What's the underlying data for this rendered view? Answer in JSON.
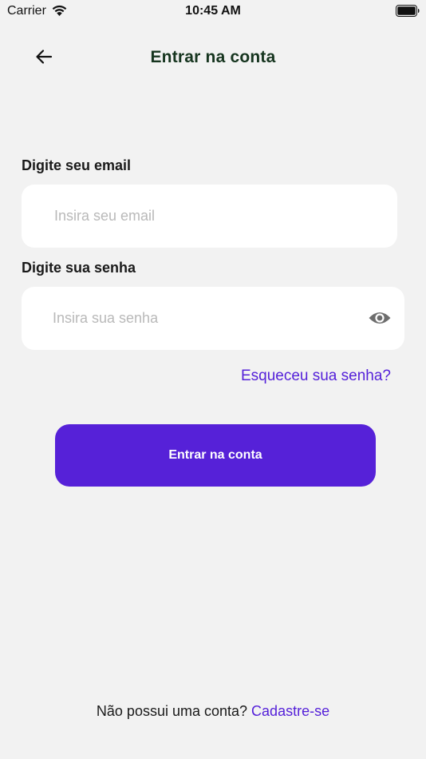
{
  "status_bar": {
    "carrier": "Carrier",
    "time": "10:45 AM"
  },
  "header": {
    "title": "Entrar na conta",
    "back_icon": "arrow-left-icon"
  },
  "form": {
    "email_label": "Digite seu email",
    "email_placeholder": "Insira seu email",
    "email_value": "",
    "password_label": "Digite sua senha",
    "password_placeholder": "Insira sua senha",
    "password_value": "",
    "password_toggle_icon": "eye-icon",
    "forgot_password": "Esqueceu sua senha?",
    "submit_label": "Entrar na conta"
  },
  "footer": {
    "no_account_text": "Não possui uma conta?",
    "signup_link": "Cadastre-se"
  },
  "colors": {
    "background": "#f2f2f2",
    "title": "#16351f",
    "accent": "#5621d8",
    "link": "#5521d9",
    "input_background": "#ffffff",
    "placeholder": "#b9b9b9"
  }
}
